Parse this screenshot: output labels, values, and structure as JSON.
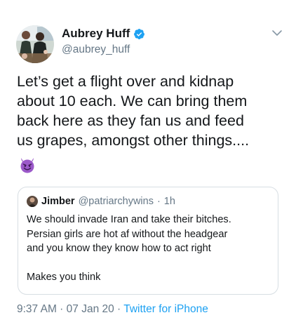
{
  "tweet": {
    "author": {
      "name": "Aubrey Huff",
      "handle": "@aubrey_huff",
      "verified": true
    },
    "text": "Let’s get a flight over and kidnap\nabout 10 each. We can bring them\nback here as they fan us and feed\nus grapes, amongst other things....",
    "emoji": "smiling-face-with-horns-icon",
    "quoted": {
      "name": "Jimber",
      "handle": "@patriarchywins",
      "separator": "·",
      "age": "1h",
      "text": "We should invade Iran and take their bitches.\nPersian girls are hot af without the headgear\nand you know they know how to act right\n\nMakes you think"
    },
    "footer": {
      "time": "9:37 AM",
      "sep1": " · ",
      "date": "07 Jan 20",
      "sep2": " · ",
      "source": "Twitter for iPhone"
    }
  },
  "colors": {
    "text": "#14171a",
    "secondary": "#657786",
    "link": "#1da1f2",
    "border": "#d7dee3",
    "devil": "#9b59c9"
  }
}
